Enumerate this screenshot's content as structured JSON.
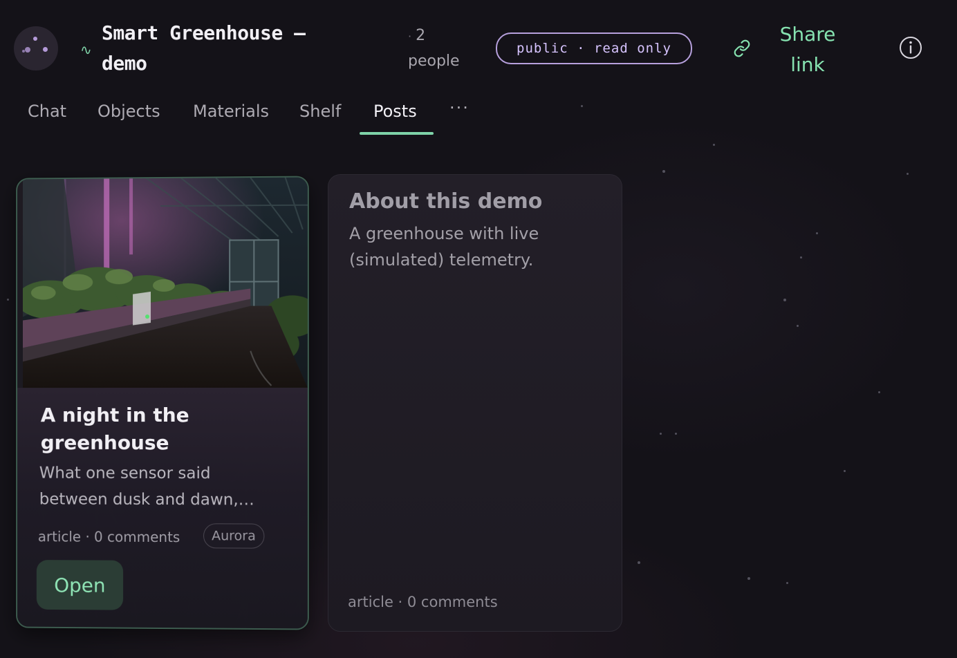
{
  "header": {
    "workspace_title": "Smart Greenhouse — demo",
    "presence_separator": "·",
    "people_count": "2",
    "people_label": "people",
    "visibility_badge": "public · read only",
    "share_label": "Share link",
    "icons": {
      "avatar": "avatar-dots-icon",
      "wave": "wave-icon",
      "link": "link-icon",
      "info": "info-icon"
    }
  },
  "tabs": [
    {
      "label": "Chat",
      "active": false
    },
    {
      "label": "Objects",
      "active": false
    },
    {
      "label": "Materials",
      "active": false
    },
    {
      "label": "Shelf",
      "active": false
    },
    {
      "label": "Posts",
      "active": true
    }
  ],
  "tabs_more": "···",
  "posts": [
    {
      "title": "A night in the greenhouse",
      "excerpt": "What one sensor said between dusk and dawn,…",
      "meta": "article · 0 comments",
      "author": "Aurora",
      "action": "Open"
    },
    {
      "title": "About this demo",
      "excerpt": "A greenhouse with live (simulated) telemetry.",
      "meta": "article · 0 comments"
    }
  ],
  "colors": {
    "background": "#141218",
    "accent_green": "#86e2b0",
    "accent_purple": "#b7a0dd",
    "tab_underline": "#7fd3a8"
  }
}
